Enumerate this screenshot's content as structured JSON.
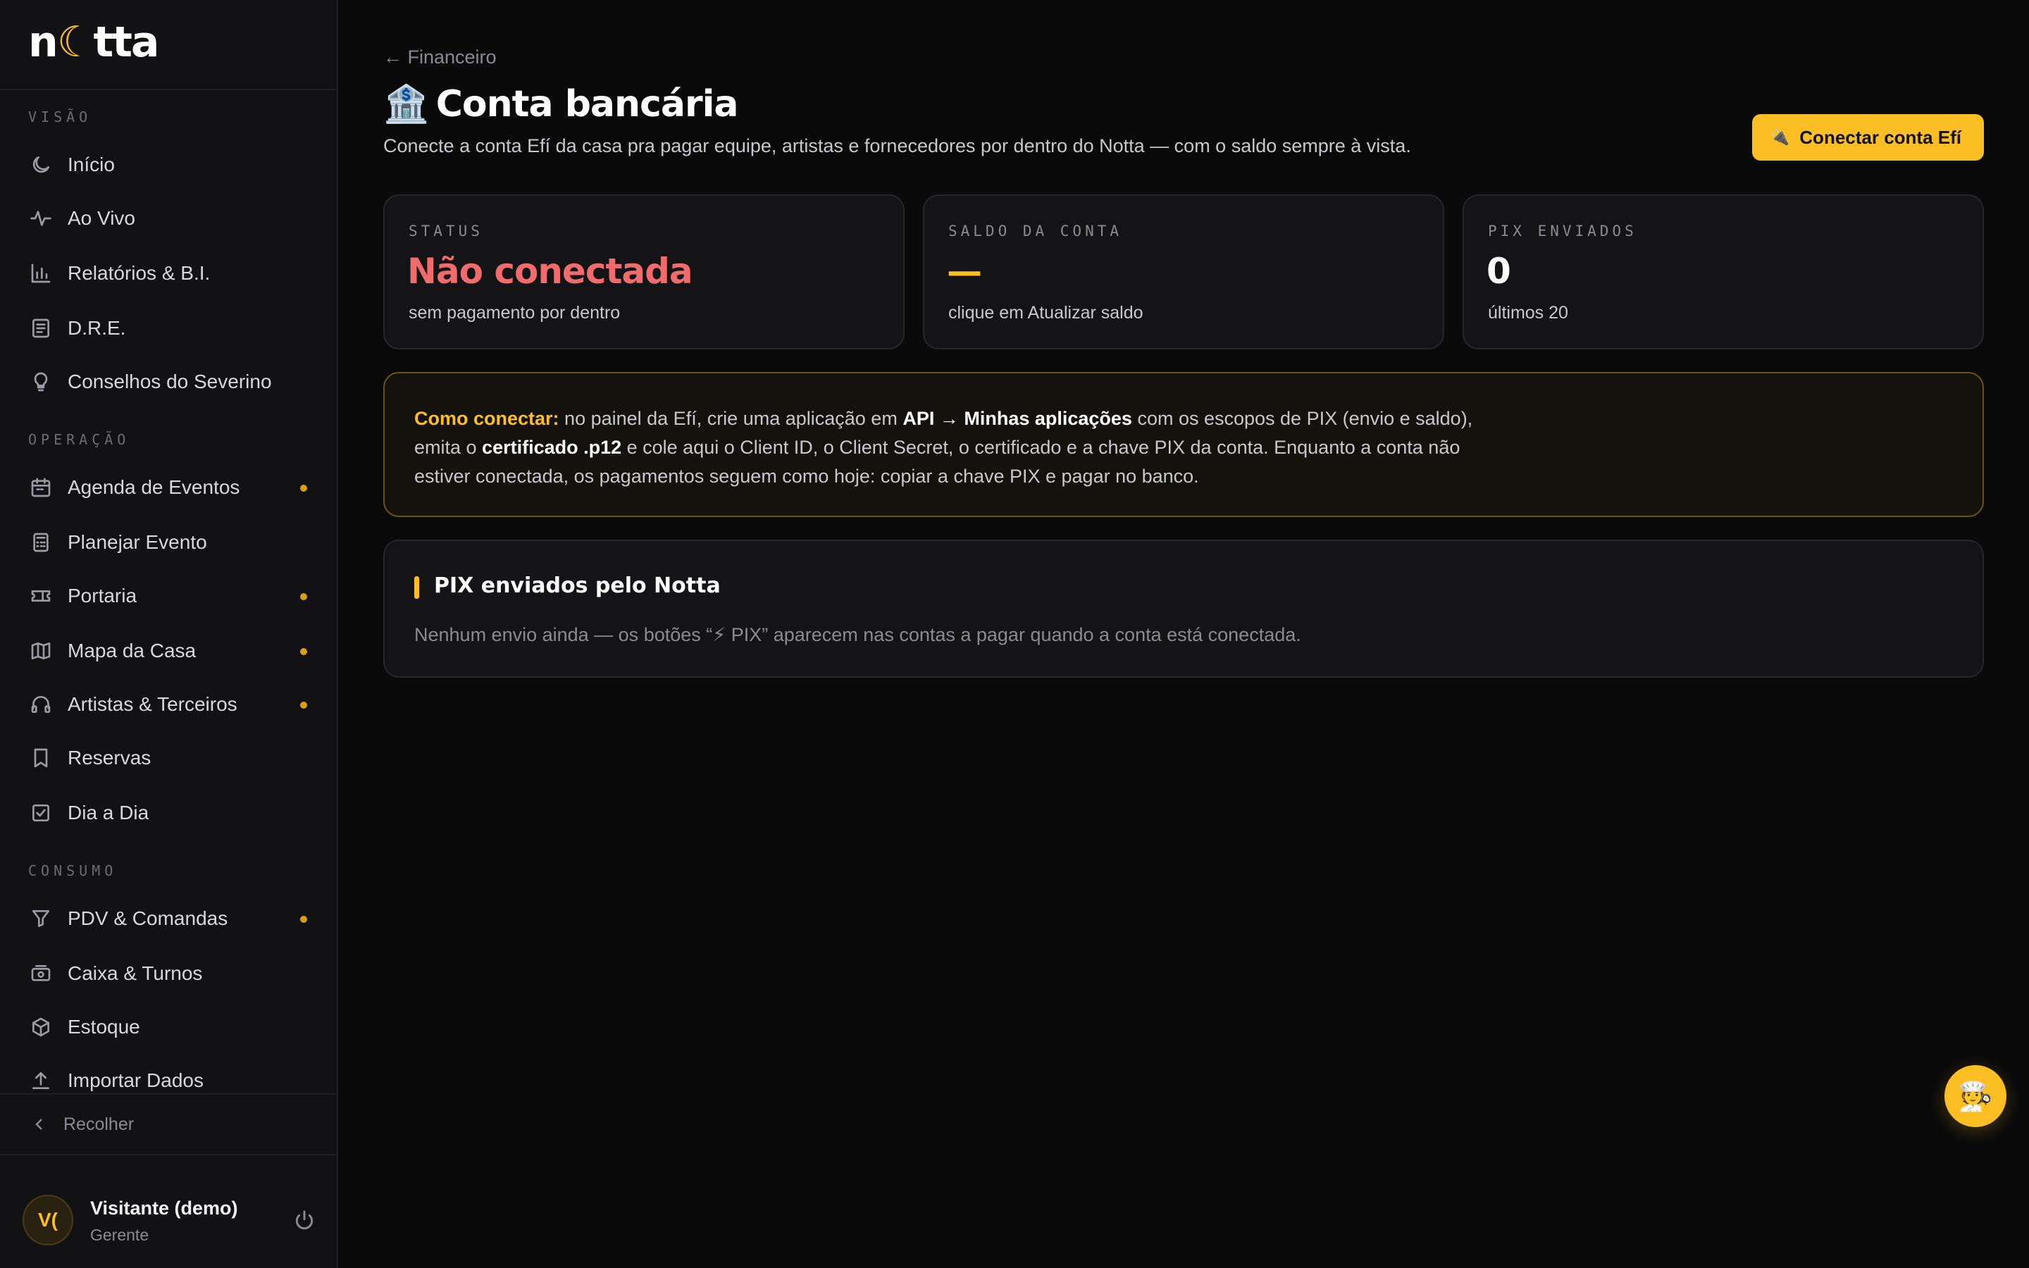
{
  "app": {
    "logo_text_a": "n",
    "logo_text_b": "tta",
    "logo_moon": "☾"
  },
  "sidebar": {
    "sections": [
      {
        "label": "VISÃO"
      },
      {
        "label": "OPERAÇÃO"
      },
      {
        "label": "CONSUMO"
      }
    ],
    "items": [
      {
        "label": "Início",
        "icon": "moon-icon",
        "dot": false
      },
      {
        "label": "Ao Vivo",
        "icon": "pulse-icon",
        "dot": false
      },
      {
        "label": "Relatórios & B.I.",
        "icon": "bar-chart-icon",
        "dot": false
      },
      {
        "label": "D.R.E.",
        "icon": "document-icon",
        "dot": false
      },
      {
        "label": "Conselhos do Severino",
        "icon": "lightbulb-icon",
        "dot": false
      },
      {
        "label": "Agenda de Eventos",
        "icon": "calendar-icon",
        "dot": true
      },
      {
        "label": "Planejar Evento",
        "icon": "calculator-icon",
        "dot": false
      },
      {
        "label": "Portaria",
        "icon": "ticket-icon",
        "dot": true
      },
      {
        "label": "Mapa da Casa",
        "icon": "map-icon",
        "dot": true
      },
      {
        "label": "Artistas & Terceiros",
        "icon": "headphones-icon",
        "dot": true
      },
      {
        "label": "Reservas",
        "icon": "bookmark-icon",
        "dot": false
      },
      {
        "label": "Dia a Dia",
        "icon": "check-square-icon",
        "dot": false
      },
      {
        "label": "PDV & Comandas",
        "icon": "filter-icon",
        "dot": true
      },
      {
        "label": "Caixa & Turnos",
        "icon": "cash-icon",
        "dot": false
      },
      {
        "label": "Estoque",
        "icon": "box-icon",
        "dot": false
      },
      {
        "label": "Importar Dados",
        "icon": "upload-icon",
        "dot": false
      }
    ],
    "collapse_label": "Recolher",
    "user": {
      "initials": "V(",
      "name": "Visitante (demo)",
      "role": "Gerente"
    }
  },
  "header": {
    "breadcrumb": "← Financeiro",
    "title_emoji": "🏦",
    "title": "Conta bancária",
    "subtitle": "Conecte a conta Efí da casa pra pagar equipe, artistas e fornecedores por dentro do Notta — com o saldo sempre à vista.",
    "connect_button_icon": "🔌",
    "connect_button": "Conectar conta Efí"
  },
  "cards": [
    {
      "label": "STATUS",
      "value": "Não conectada",
      "note": "sem pagamento por dentro",
      "tone": "red"
    },
    {
      "label": "SALDO DA CONTA",
      "value": "—",
      "note": "clique em Atualizar saldo",
      "tone": "yellow"
    },
    {
      "label": "PIX ENVIADOS",
      "value": "0",
      "note": "últimos 20",
      "tone": "white"
    }
  ],
  "howto": {
    "lead": "Como conectar:",
    "t1": " no painel da Efí, crie uma aplicação em ",
    "b1": "API → Minhas aplicações",
    "t2": " com os escopos de PIX (envio e saldo), emita o ",
    "b2": "certificado .p12",
    "t3": " e cole aqui o Client ID, o Client Secret, o certificado e a chave PIX da conta. Enquanto a conta não estiver conectada, os pagamentos seguem como hoje: copiar a chave PIX e pagar no banco."
  },
  "pix_panel": {
    "title": "PIX enviados pelo Notta",
    "empty": "Nenhum envio ainda — os botões “⚡ PIX” aparecem nas contas a pagar quando a conta está conectada."
  },
  "fab": {
    "icon": "🧑‍🍳"
  }
}
